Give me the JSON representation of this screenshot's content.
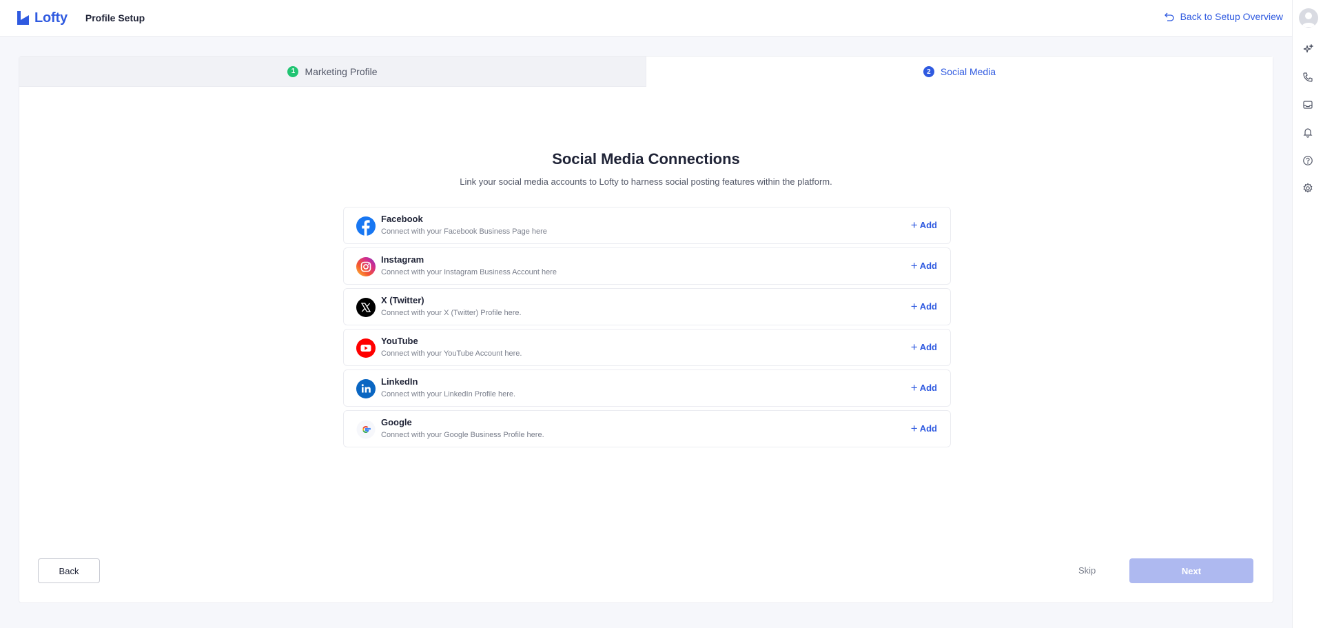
{
  "header": {
    "logo_text": "Lofty",
    "page_title": "Profile Setup",
    "back_link": "Back to Setup Overview"
  },
  "tabs": [
    {
      "step": "1",
      "label": "Marketing Profile",
      "state": "done"
    },
    {
      "step": "2",
      "label": "Social Media",
      "state": "current"
    }
  ],
  "content": {
    "title": "Social Media Connections",
    "subtitle": "Link your social media accounts to Lofty to harness social posting features within the platform."
  },
  "connections": [
    {
      "icon": "facebook-icon",
      "name": "Facebook",
      "desc": "Connect with your Facebook Business Page here",
      "action": "Add"
    },
    {
      "icon": "instagram-icon",
      "name": "Instagram",
      "desc": "Connect with your Instagram Business Account here",
      "action": "Add"
    },
    {
      "icon": "x-twitter-icon",
      "name": "X (Twitter)",
      "desc": "Connect with your X (Twitter) Profile here.",
      "action": "Add"
    },
    {
      "icon": "youtube-icon",
      "name": "YouTube",
      "desc": "Connect with your YouTube Account here.",
      "action": "Add"
    },
    {
      "icon": "linkedin-icon",
      "name": "LinkedIn",
      "desc": "Connect with your LinkedIn Profile here.",
      "action": "Add"
    },
    {
      "icon": "google-icon",
      "name": "Google",
      "desc": "Connect with your Google Business Profile here.",
      "action": "Add"
    }
  ],
  "footer": {
    "back": "Back",
    "skip": "Skip",
    "next": "Next"
  },
  "colors": {
    "accent": "#2f5ae0",
    "step_done": "#20c472",
    "next_disabled": "#aeb9f0"
  }
}
